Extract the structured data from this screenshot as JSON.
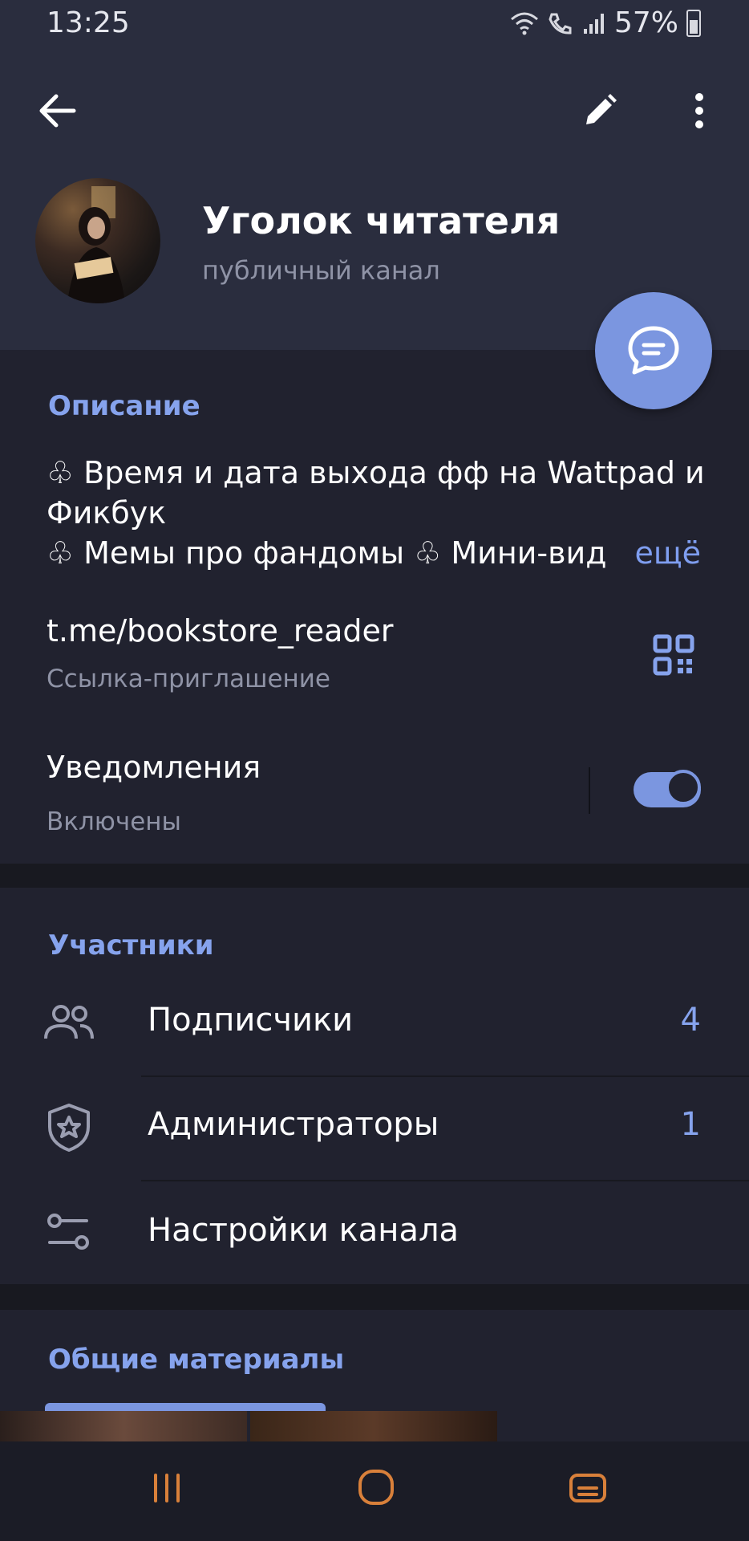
{
  "status_bar": {
    "time": "13:25",
    "battery": "57%"
  },
  "channel": {
    "title": "Уголок читателя",
    "subtitle": "публичный канал"
  },
  "description": {
    "section_title": "Описание",
    "line1": "♧ Время и дата выхода фф на Wattpad и Фикбук",
    "line2": "♧ Мемы про фандомы ♧ Мини-вид",
    "more": "ещё"
  },
  "link": {
    "url": "t.me/bookstore_reader",
    "label": "Ссылка-приглашение"
  },
  "notifications": {
    "title": "Уведомления",
    "status": "Включены",
    "enabled": true
  },
  "members": {
    "section_title": "Участники",
    "items": [
      {
        "label": "Подписчики",
        "count": "4",
        "icon": "users-icon"
      },
      {
        "label": "Администраторы",
        "count": "1",
        "icon": "shield-star-icon"
      },
      {
        "label": "Настройки канала",
        "count": "",
        "icon": "settings-sliders-icon"
      }
    ]
  },
  "shared": {
    "section_title": "Общие материалы"
  },
  "colors": {
    "accent": "#7b96e0",
    "background": "#21222f",
    "header": "#2a2d3e"
  }
}
